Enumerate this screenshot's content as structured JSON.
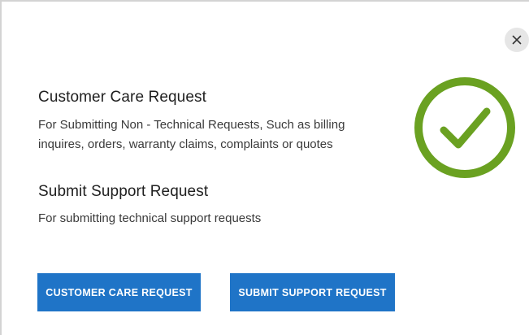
{
  "dialog": {
    "close_icon": "close-icon",
    "success_icon": "checkmark-circle-icon",
    "accent_color": "#1f74c7",
    "success_color": "#6aa121"
  },
  "customer_care": {
    "title": "Customer Care Request",
    "description_line1": "For Submitting Non - Technical Requests, Such as billing",
    "description_line2": "inquires, orders, warranty claims, complaints or quotes",
    "button_label": "CUSTOMER CARE REQUEST"
  },
  "support": {
    "title": "Submit Support Request",
    "description": "For submitting technical support requests",
    "button_label": "SUBMIT SUPPORT REQUEST"
  }
}
